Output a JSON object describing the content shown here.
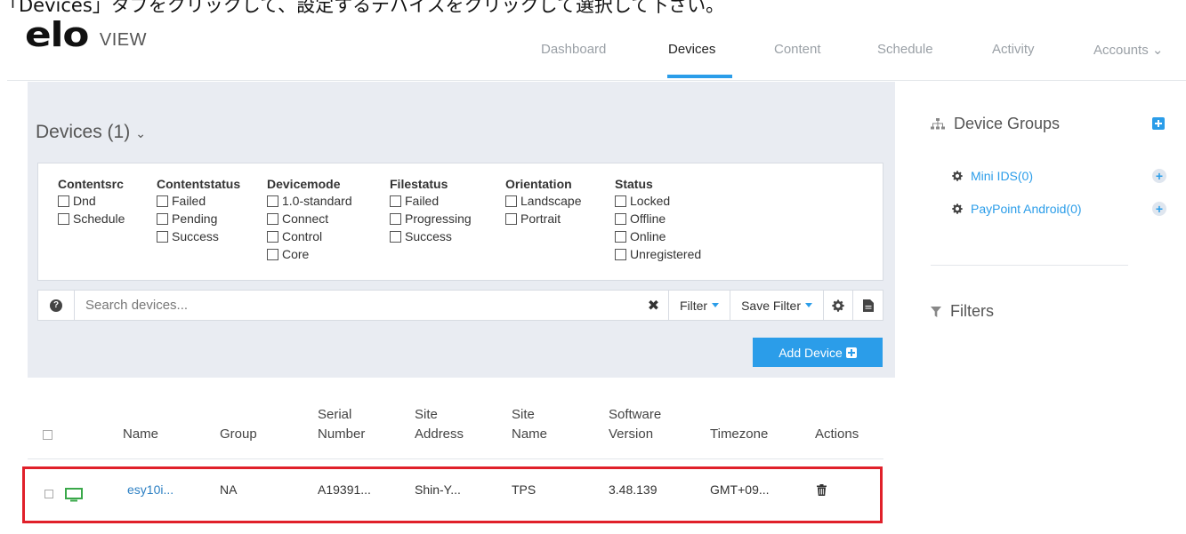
{
  "instruction": "「Devices」タブをクリックして、設定するデバイスをクリックして選択して下さい。",
  "logo": {
    "main": "elo",
    "sub": "VIEW"
  },
  "nav": {
    "items": [
      {
        "label": "Dashboard"
      },
      {
        "label": "Devices"
      },
      {
        "label": "Content"
      },
      {
        "label": "Schedule"
      },
      {
        "label": "Activity"
      },
      {
        "label": "Accounts ⌄"
      }
    ],
    "active": "Devices"
  },
  "devices_panel": {
    "title": "Devices (1)",
    "filter_groups": [
      {
        "heading": "Contentsrc",
        "options": [
          "Dnd",
          "Schedule"
        ]
      },
      {
        "heading": "Contentstatus",
        "options": [
          "Failed",
          "Pending",
          "Success"
        ]
      },
      {
        "heading": "Devicemode",
        "options": [
          "1.0-standard",
          "Connect",
          "Control",
          "Core"
        ]
      },
      {
        "heading": "Filestatus",
        "options": [
          "Failed",
          "Progressing",
          "Success"
        ]
      },
      {
        "heading": "Orientation",
        "options": [
          "Landscape",
          "Portrait"
        ]
      },
      {
        "heading": "Status",
        "options": [
          "Locked",
          "Offline",
          "Online",
          "Unregistered"
        ]
      }
    ],
    "search": {
      "placeholder": "Search devices...",
      "value": ""
    },
    "filter_label": "Filter",
    "save_filter_label": "Save Filter",
    "add_device_label": "Add Device"
  },
  "table": {
    "headers": [
      [
        "Name"
      ],
      [
        "Group"
      ],
      [
        "Serial",
        "Number"
      ],
      [
        "Site",
        "Address"
      ],
      [
        "Site",
        "Name"
      ],
      [
        "Software",
        "Version"
      ],
      [
        "Timezone"
      ],
      [
        "Actions"
      ]
    ],
    "rows": [
      {
        "name": "esy10i...",
        "group": "NA",
        "serial": "A19391...",
        "site_address": "Shin-Y...",
        "site_name": "TPS",
        "software_version": "3.48.139",
        "timezone": "GMT+09..."
      }
    ]
  },
  "sidebar": {
    "device_groups_title": "Device Groups",
    "groups": [
      {
        "label": "Mini IDS(0)"
      },
      {
        "label": "PayPoint Android(0)"
      }
    ],
    "filters_title": "Filters"
  },
  "colors": {
    "accent": "#2b9de9",
    "highlight": "#e0202a",
    "panel_bg": "#e9ecf2",
    "device_icon": "#3aa84a"
  },
  "icons": [
    "help-icon",
    "clear-icon",
    "gear-icon",
    "document-icon",
    "add-icon",
    "monitor-icon",
    "trash-icon",
    "sitemap-icon",
    "filter-icon"
  ]
}
